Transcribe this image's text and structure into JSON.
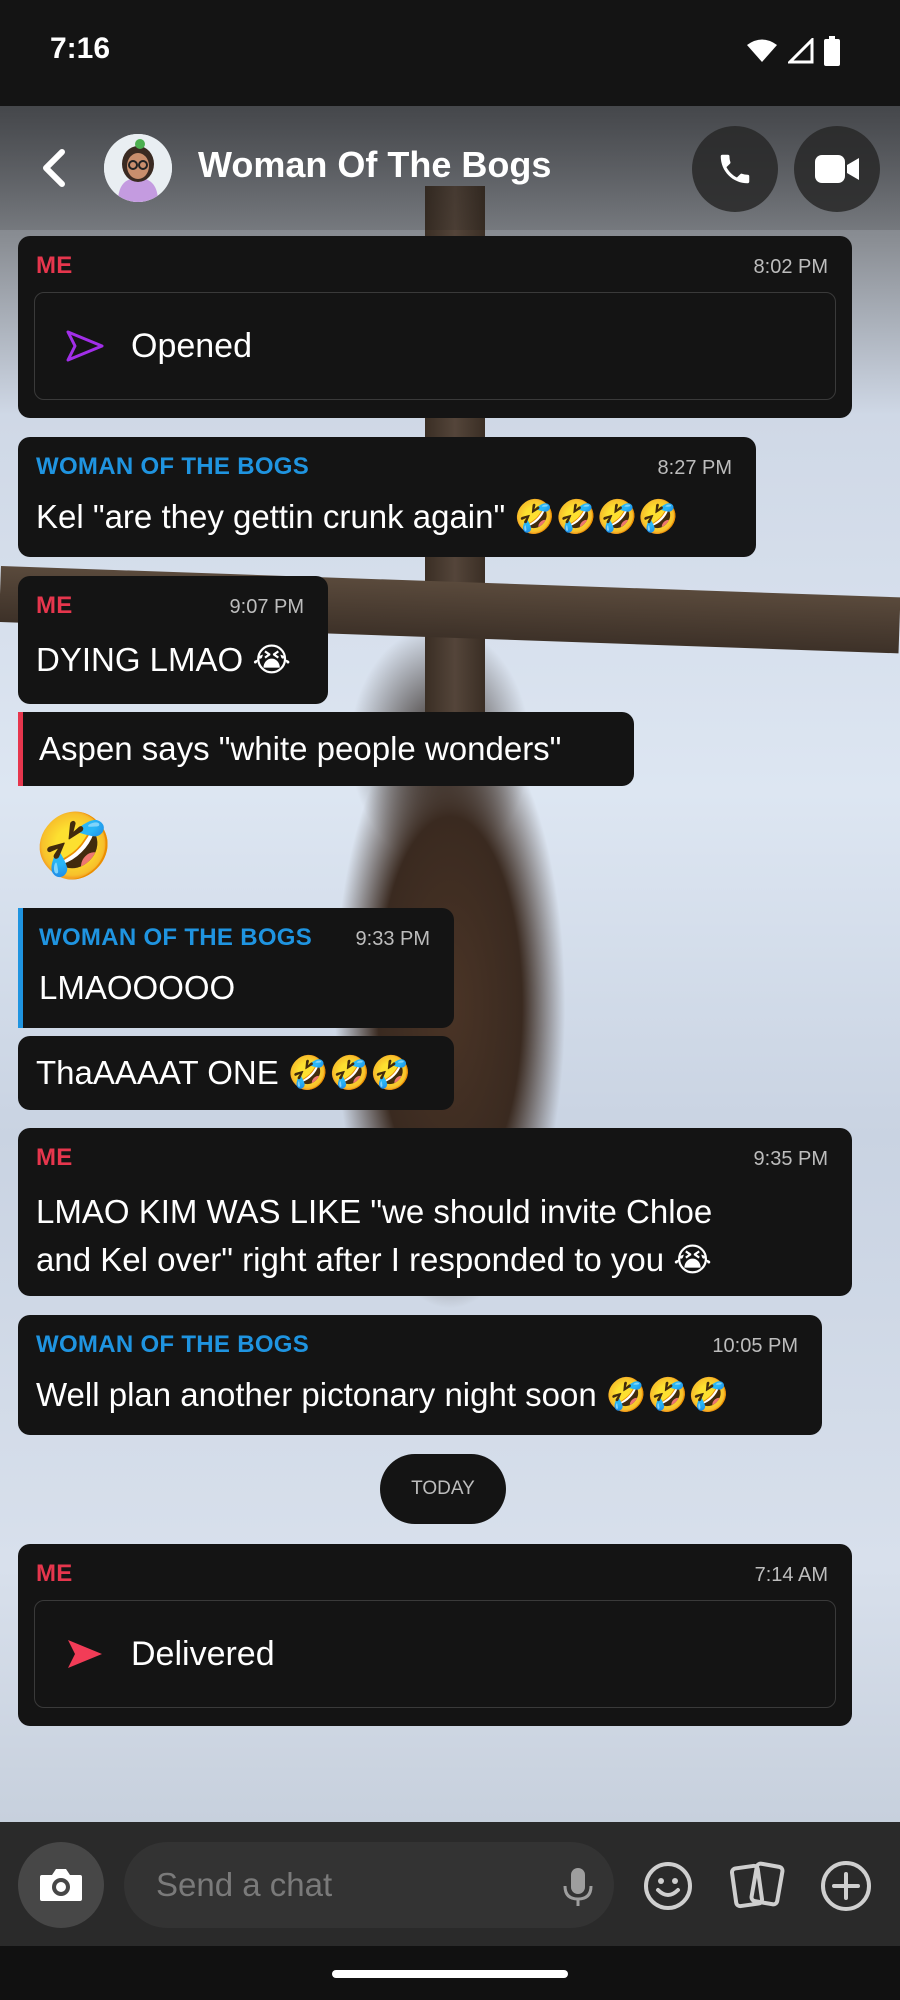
{
  "status_bar": {
    "time": "7:16"
  },
  "header": {
    "title": "Woman Of The Bogs"
  },
  "messages": [
    {
      "sender": "ME",
      "time": "8:02 PM",
      "status": "Opened"
    },
    {
      "sender": "WOMAN OF THE BOGS",
      "time": "8:27 PM",
      "text": "Kel \"are they gettin crunk again\" 🤣🤣🤣🤣"
    },
    {
      "sender": "ME",
      "time": "9:07 PM",
      "text": "DYING LMAO 😭"
    },
    {
      "text": "Aspen says \"white people wonders\""
    },
    {
      "text": "🤣"
    },
    {
      "sender": "WOMAN OF THE BOGS",
      "time": "9:33 PM",
      "text": "LMAOOOOO"
    },
    {
      "text": "ThaAAAAT ONE 🤣🤣🤣"
    },
    {
      "sender": "ME",
      "time": "9:35 PM",
      "line1": "LMAO KIM WAS LIKE \"we should invite Chloe",
      "line2": "and Kel over\" right after I responded to you 😭"
    },
    {
      "sender": "WOMAN OF THE BOGS",
      "time": "10:05 PM",
      "text": "Well plan another pictonary night soon 🤣🤣🤣"
    },
    {
      "sender": "ME",
      "time": "7:14 AM",
      "status": "Delivered"
    }
  ],
  "day_divider": "TODAY",
  "composer": {
    "placeholder": "Send a chat"
  },
  "colors": {
    "me": "#e6364d",
    "her": "#1f94e0",
    "opened": "#a12ee8",
    "delivered": "#f23c57"
  }
}
